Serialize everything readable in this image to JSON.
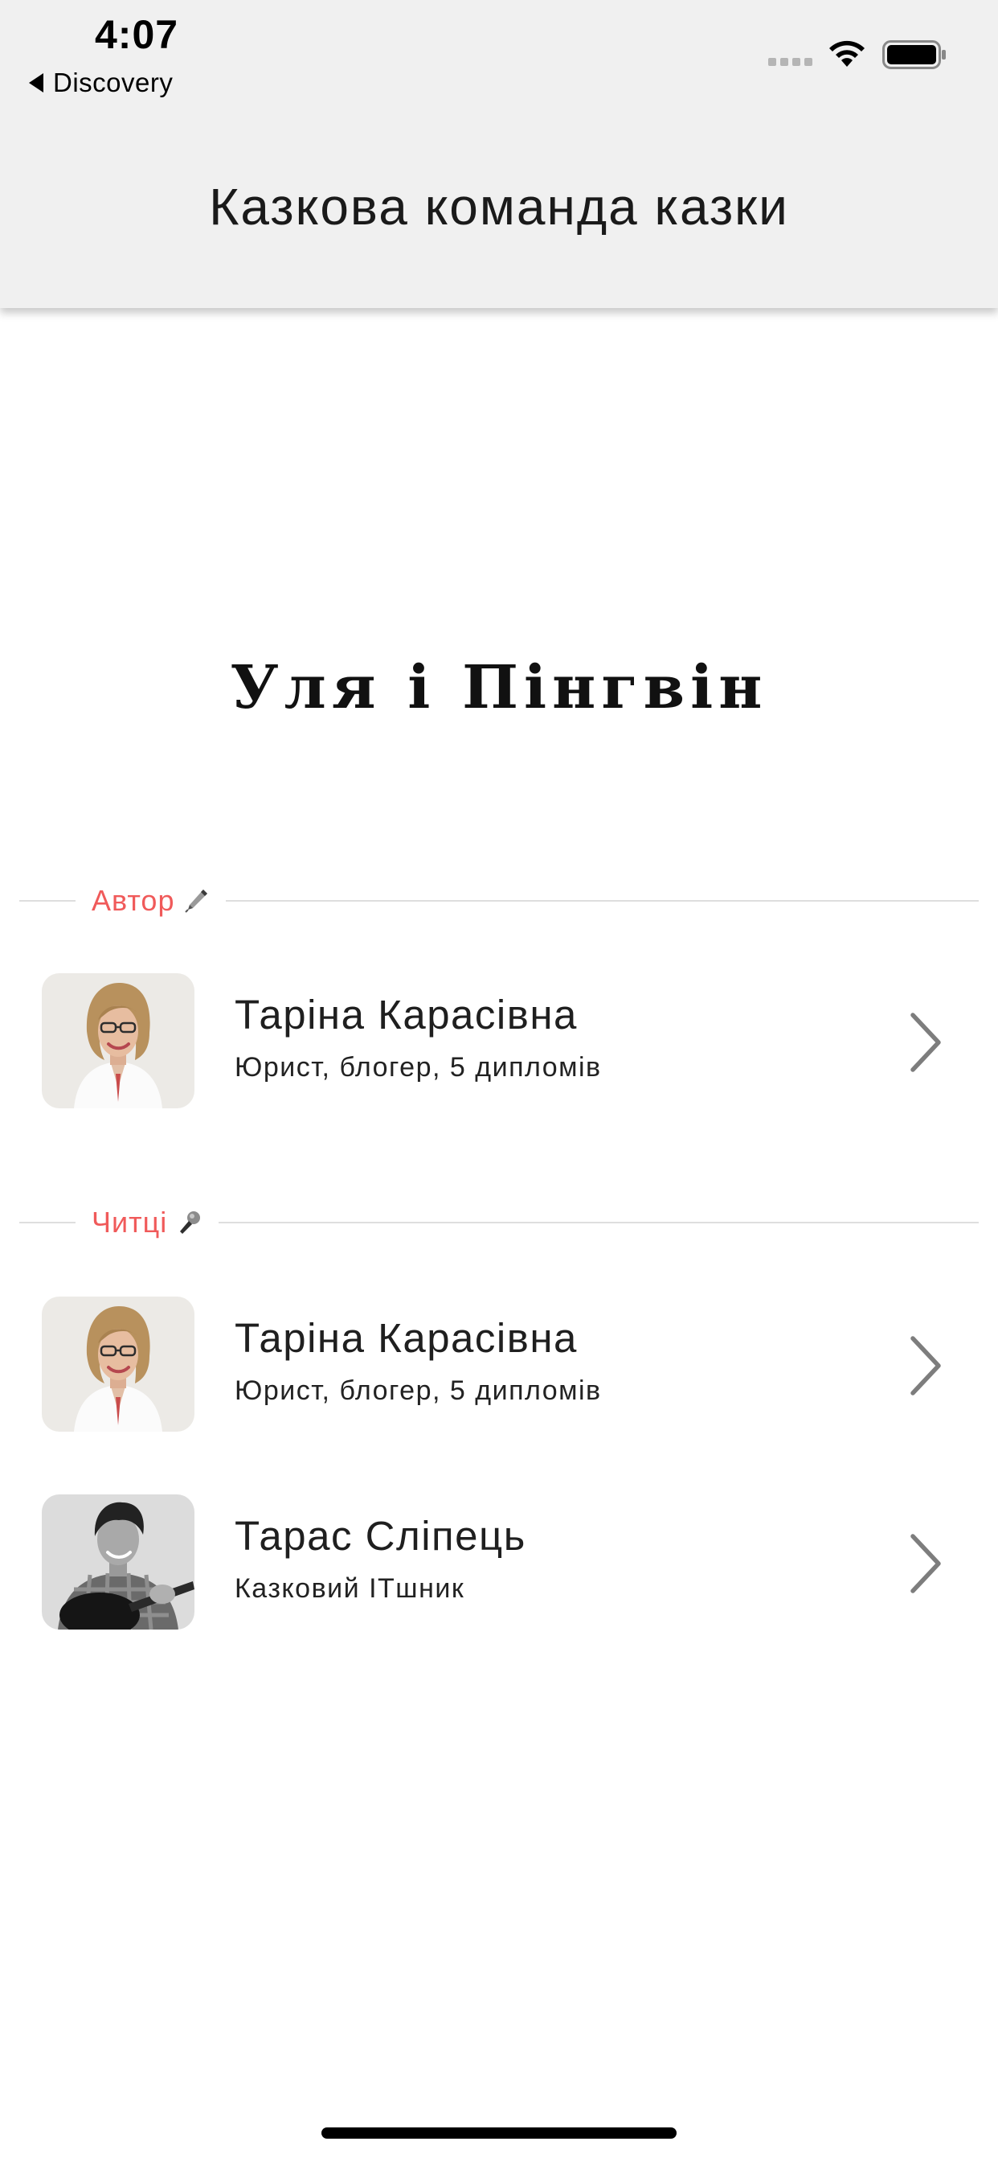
{
  "status_bar": {
    "time": "4:07",
    "back_label": "Discovery",
    "signal_icon": "cellular-signal-icon",
    "wifi_icon": "wifi-icon",
    "battery_icon": "battery-icon"
  },
  "header": {
    "title": "Казкова команда казки"
  },
  "story": {
    "title": "Уля і Пінгвін"
  },
  "sections": {
    "author": {
      "label": "Автор",
      "icon": "pen-icon",
      "accent_color": "#f05a5a"
    },
    "readers": {
      "label": "Читці",
      "icon": "microphone-icon",
      "accent_color": "#f05a5a"
    }
  },
  "author": {
    "name": "Таріна Карасівна",
    "description": "Юрист, блогер, 5 дипломів",
    "avatar_icon": "woman-portrait-photo"
  },
  "readers": [
    {
      "name": "Таріна Карасівна",
      "description": "Юрист, блогер, 5 дипломів",
      "avatar_icon": "woman-portrait-photo"
    },
    {
      "name": "Тарас Сліпець",
      "description": "Казковий ІТшник",
      "avatar_icon": "man-with-guitar-photo"
    }
  ]
}
